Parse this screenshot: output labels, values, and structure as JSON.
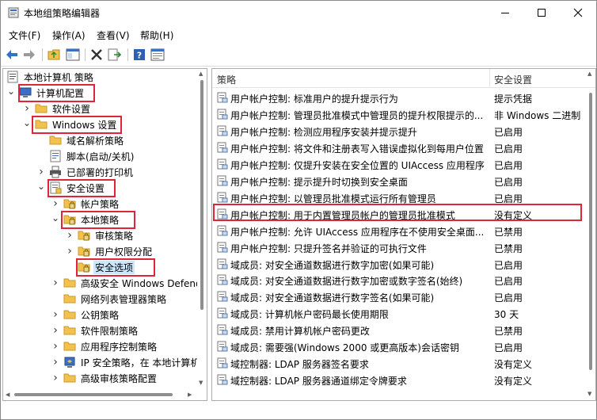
{
  "window": {
    "title": "本地组策略编辑器"
  },
  "menu": [
    "文件(F)",
    "操作(A)",
    "查看(V)",
    "帮助(H)"
  ],
  "toolbar_icons": [
    "back-arrow-icon",
    "forward-arrow-icon",
    "folder-up-icon",
    "show-hide-tree-icon",
    "delete-icon",
    "export-list-icon",
    "help-icon",
    "properties-icon"
  ],
  "tree": {
    "items": [
      {
        "label": "本地计算机 策略",
        "level": 0,
        "chev": "",
        "icon": "computer-policy-icon"
      },
      {
        "label": "计算机配置",
        "level": 0,
        "chev": "v",
        "icon": "computer-icon"
      },
      {
        "label": "软件设置",
        "level": 1,
        "chev": ">",
        "icon": "folder-icon"
      },
      {
        "label": "Windows 设置",
        "level": 1,
        "chev": "v",
        "icon": "folder-icon"
      },
      {
        "label": "域名解析策略",
        "level": 2,
        "chev": "",
        "icon": "folder-icon"
      },
      {
        "label": "脚本(启动/关机)",
        "level": 2,
        "chev": "",
        "icon": "script-icon"
      },
      {
        "label": "已部署的打印机",
        "level": 2,
        "chev": ">",
        "icon": "printer-icon"
      },
      {
        "label": "安全设置",
        "level": 2,
        "chev": "v",
        "icon": "security-settings-icon"
      },
      {
        "label": "帐户策略",
        "level": 3,
        "chev": ">",
        "icon": "security-folder-icon"
      },
      {
        "label": "本地策略",
        "level": 3,
        "chev": "v",
        "icon": "security-folder-icon"
      },
      {
        "label": "审核策略",
        "level": 4,
        "chev": ">",
        "icon": "security-folder-icon"
      },
      {
        "label": "用户权限分配",
        "level": 4,
        "chev": ">",
        "icon": "security-folder-icon"
      },
      {
        "label": "安全选项",
        "level": 4,
        "chev": "",
        "icon": "security-folder-icon"
      },
      {
        "label": "高级安全 Windows Defender 防火墙",
        "level": 3,
        "chev": ">",
        "icon": "folder-icon"
      },
      {
        "label": "网络列表管理器策略",
        "level": 3,
        "chev": "",
        "icon": "folder-icon"
      },
      {
        "label": "公钥策略",
        "level": 3,
        "chev": ">",
        "icon": "folder-icon"
      },
      {
        "label": "软件限制策略",
        "level": 3,
        "chev": ">",
        "icon": "folder-icon"
      },
      {
        "label": "应用程序控制策略",
        "level": 3,
        "chev": ">",
        "icon": "folder-icon"
      },
      {
        "label": "IP 安全策略，在 本地计算机",
        "level": 3,
        "chev": ">",
        "icon": "ip-security-icon"
      },
      {
        "label": "高级审核策略配置",
        "level": 3,
        "chev": ">",
        "icon": "folder-icon"
      }
    ]
  },
  "list": {
    "columns": {
      "policy": "策略",
      "setting": "安全设置"
    },
    "rows": [
      {
        "policy": "用户帐户控制: 标准用户的提升提示行为",
        "setting": "提示凭据"
      },
      {
        "policy": "用户帐户控制: 管理员批准模式中管理员的提升权限提示的...",
        "setting": "非 Windows 二进制"
      },
      {
        "policy": "用户帐户控制: 检测应用程序安装并提示提升",
        "setting": "已启用"
      },
      {
        "policy": "用户帐户控制: 将文件和注册表写入错误虚拟化到每用户位置",
        "setting": "已启用"
      },
      {
        "policy": "用户帐户控制: 仅提升安装在安全位置的 UIAccess 应用程序",
        "setting": "已启用"
      },
      {
        "policy": "用户帐户控制: 提示提升时切换到安全桌面",
        "setting": "已启用"
      },
      {
        "policy": "用户帐户控制: 以管理员批准模式运行所有管理员",
        "setting": "已启用"
      },
      {
        "policy": "用户帐户控制: 用于内置管理员帐户的管理员批准模式",
        "setting": "没有定义"
      },
      {
        "policy": "用户帐户控制: 允许 UIAccess 应用程序在不使用安全桌面...",
        "setting": "已禁用"
      },
      {
        "policy": "用户帐户控制: 只提升签名并验证的可执行文件",
        "setting": "已禁用"
      },
      {
        "policy": "域成员: 对安全通道数据进行数字加密(如果可能)",
        "setting": "已启用"
      },
      {
        "policy": "域成员: 对安全通道数据进行数字加密或数字签名(始终)",
        "setting": "已启用"
      },
      {
        "policy": "域成员: 对安全通道数据进行数字签名(如果可能)",
        "setting": "已启用"
      },
      {
        "policy": "域成员: 计算机帐户密码最长使用期限",
        "setting": "30 天"
      },
      {
        "policy": "域成员: 禁用计算机帐户密码更改",
        "setting": "已禁用"
      },
      {
        "policy": "域成员: 需要强(Windows 2000 或更高版本)会话密钥",
        "setting": "已启用"
      },
      {
        "policy": "域控制器: LDAP 服务器签名要求",
        "setting": "没有定义"
      },
      {
        "policy": "域控制器: LDAP 服务器通道绑定令牌要求",
        "setting": "没有定义"
      }
    ]
  },
  "colors": {
    "highlight_red": "#e0243a",
    "folder_yellow": "#f2c14e",
    "selection_blue": "#cce8ff"
  }
}
